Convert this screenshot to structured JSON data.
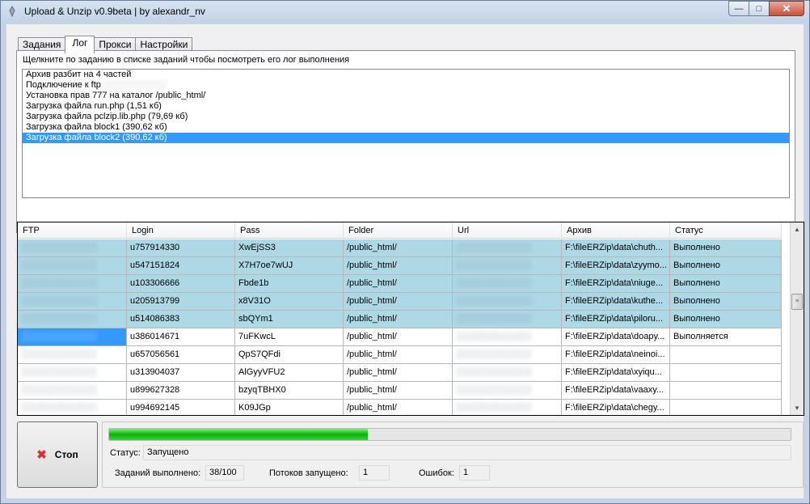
{
  "window": {
    "title": "Upload & Unzip v0.9beta | by alexandr_nv"
  },
  "tabs": [
    {
      "label": "Задания",
      "active": false
    },
    {
      "label": "Лог",
      "active": true
    },
    {
      "label": "Прокси",
      "active": false
    },
    {
      "label": "Настройки",
      "active": false
    }
  ],
  "log": {
    "hint": "Щелкните по заданию в списке заданий чтобы посмотреть его лог выполнения",
    "lines": [
      "Архив разбит на 4 частей",
      "Подключение к ftp",
      "Установка прав 777 на каталог /public_html/",
      "Загрузка файла run.php (1,51 кб)",
      "Загрузка файла pclzip.lib.php (79,69 кб)",
      "Загрузка файла block1 (390,62 кб)",
      "Загрузка файла block2 (390,62 кб)"
    ],
    "selected_index": 6
  },
  "grid": {
    "columns": [
      "FTP",
      "Login",
      "Pass",
      "Folder",
      "Url",
      "Архив",
      "Статус"
    ],
    "rows": [
      {
        "login": "u757914330",
        "pass": "XwEjSS3",
        "folder": "/public_html/",
        "archive": "F:\\fileERZip\\data\\chuth...",
        "status": "Выполнено",
        "done": true
      },
      {
        "login": "u547151824",
        "pass": "X7H7oe7wUJ",
        "folder": "/public_html/",
        "archive": "F:\\fileERZip\\data\\zyymo...",
        "status": "Выполнено",
        "done": true
      },
      {
        "login": "u103306666",
        "pass": "Fbde1b",
        "folder": "/public_html/",
        "archive": "F:\\fileERZip\\data\\niuge...",
        "status": "Выполнено",
        "done": true
      },
      {
        "login": "u205913799",
        "pass": "x8V31O",
        "folder": "/public_html/",
        "archive": "F:\\fileERZip\\data\\kuthe...",
        "status": "Выполнено",
        "done": true
      },
      {
        "login": "u514086383",
        "pass": "sbQYm1",
        "folder": "/public_html/",
        "archive": "F:\\fileERZip\\data\\piloru...",
        "status": "Выполнено",
        "done": true
      },
      {
        "login": "u386014671",
        "pass": "7uFKwcL",
        "folder": "/public_html/",
        "archive": "F:\\fileERZip\\data\\doapy...",
        "status": "Выполняется",
        "done": false,
        "current": true
      },
      {
        "login": "u657056561",
        "pass": "QpS7QFdi",
        "folder": "/public_html/",
        "archive": "F:\\fileERZip\\data\\neinoi...",
        "status": "",
        "done": false
      },
      {
        "login": "u313904037",
        "pass": "AlGyyVFU2",
        "folder": "/public_html/",
        "archive": "F:\\fileERZip\\data\\xyiqu...",
        "status": "",
        "done": false
      },
      {
        "login": "u899627328",
        "pass": "bzyqTBHX0",
        "folder": "/public_html/",
        "archive": "F:\\fileERZip\\data\\vaaxy...",
        "status": "",
        "done": false
      },
      {
        "login": "u994692145",
        "pass": "K09JGp",
        "folder": "/public_html/",
        "archive": "F:\\fileERZip\\data\\chegy...",
        "status": "",
        "done": false
      }
    ]
  },
  "controls": {
    "stop_label": "Стоп",
    "progress_percent": 38,
    "status_label": "Статус:",
    "status_value": "Запущено",
    "tasks_done_label": "Заданий выполнено:",
    "tasks_done_value": "38/100",
    "threads_label": "Потоков запущено:",
    "threads_value": "1",
    "errors_label": "Ошибок:",
    "errors_value": "1"
  },
  "colors": {
    "done_row": "#add8e6",
    "selection": "#3399ff",
    "progress": "#07b307",
    "stop_icon": "#d9342b"
  }
}
